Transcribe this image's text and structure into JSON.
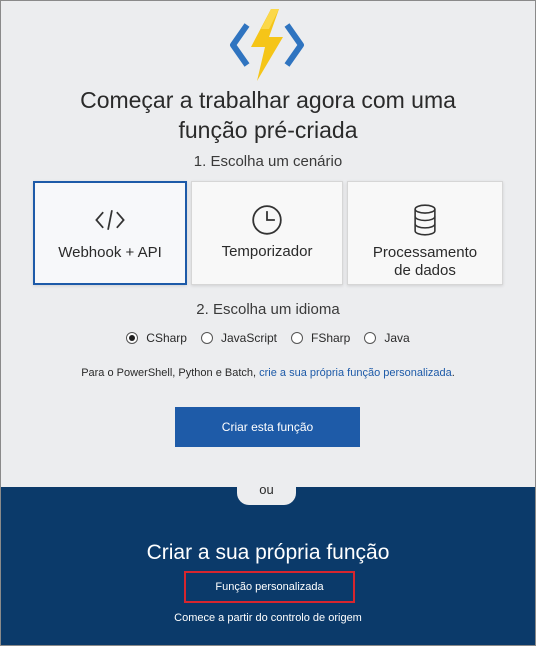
{
  "header": {
    "title_line1": "Começar a trabalhar agora com uma",
    "title_line2": "função pré-criada"
  },
  "step1": {
    "label": "1. Escolha um cenário",
    "scenarios": [
      {
        "label": "Webhook + API",
        "icon": "code-icon",
        "selected": true
      },
      {
        "label": "Temporizador",
        "icon": "clock-icon",
        "selected": false
      },
      {
        "label_line1": "Processamento",
        "label_line2": "de dados",
        "icon": "database-icon",
        "selected": false
      }
    ]
  },
  "step2": {
    "label": "2. Escolha um idioma",
    "languages": [
      {
        "label": "CSharp",
        "checked": true
      },
      {
        "label": "JavaScript",
        "checked": false
      },
      {
        "label": "FSharp",
        "checked": false
      },
      {
        "label": "Java",
        "checked": false
      }
    ]
  },
  "note": {
    "text": "Para o PowerShell, Python e Batch, ",
    "link": "crie a sua própria função personalizada",
    "suffix": "."
  },
  "create_button": "Criar esta função",
  "divider": "ou",
  "own": {
    "title": "Criar a sua própria função",
    "custom_link": "Função personalizada",
    "source_link": "Comece a partir do controlo de origem"
  },
  "colors": {
    "accent": "#1e5ba8",
    "dark_panel": "#0b3a6a",
    "highlight_box": "#d7262e",
    "bolt": "#f5c518"
  }
}
